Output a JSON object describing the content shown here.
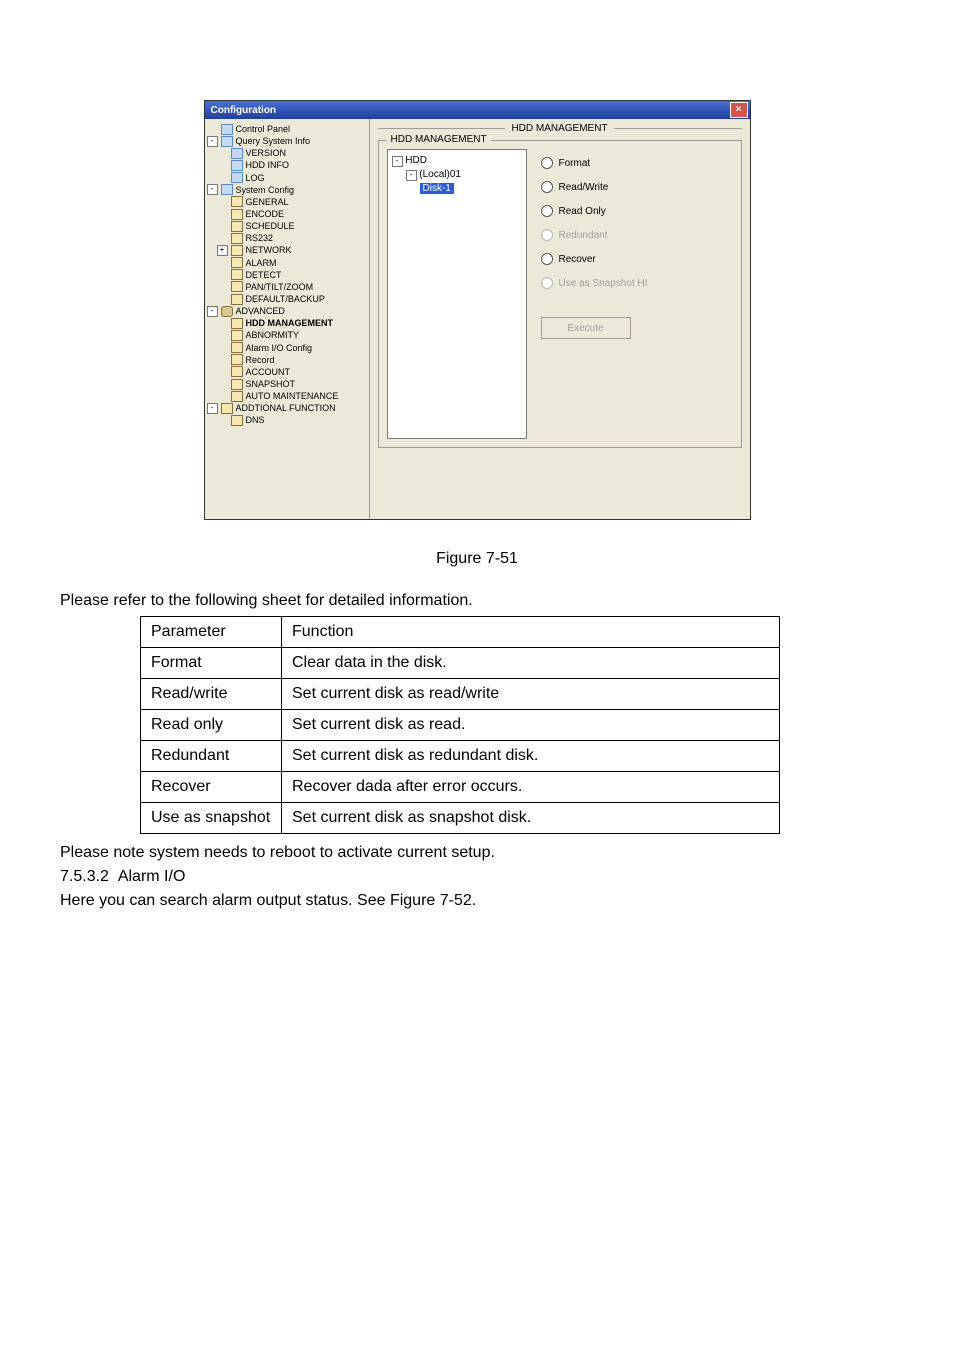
{
  "shot": {
    "title": "Configuration",
    "close_tip": "Close",
    "panel_title": "HDD MANAGEMENT",
    "groupbox_label": "HDD MANAGEMENT",
    "tree": [
      {
        "lv": 0,
        "ico": "sys",
        "label": "Control Panel",
        "exp": ""
      },
      {
        "lv": 0,
        "ico": "sys",
        "label": "Query System Info",
        "exp": "-"
      },
      {
        "lv": 1,
        "ico": "sys",
        "label": "VERSION"
      },
      {
        "lv": 1,
        "ico": "sys",
        "label": "HDD INFO"
      },
      {
        "lv": 1,
        "ico": "sys",
        "label": "LOG"
      },
      {
        "lv": 0,
        "ico": "sys",
        "label": "System Config",
        "exp": "-"
      },
      {
        "lv": 1,
        "ico": "folder",
        "label": "GENERAL"
      },
      {
        "lv": 1,
        "ico": "folder",
        "label": "ENCODE"
      },
      {
        "lv": 1,
        "ico": "folder",
        "label": "SCHEDULE"
      },
      {
        "lv": 1,
        "ico": "folder",
        "label": "RS232"
      },
      {
        "lv": 1,
        "ico": "folder",
        "label": "NETWORK",
        "exp": "+"
      },
      {
        "lv": 1,
        "ico": "folder",
        "label": "ALARM"
      },
      {
        "lv": 1,
        "ico": "folder",
        "label": "DETECT"
      },
      {
        "lv": 1,
        "ico": "folder",
        "label": "PAN/TILT/ZOOM"
      },
      {
        "lv": 1,
        "ico": "folder",
        "label": "DEFAULT/BACKUP"
      },
      {
        "lv": 0,
        "ico": "gear",
        "label": "ADVANCED",
        "exp": "-"
      },
      {
        "lv": 1,
        "ico": "folder",
        "label": "HDD MANAGEMENT",
        "bold": true
      },
      {
        "lv": 1,
        "ico": "folder",
        "label": "ABNORMITY"
      },
      {
        "lv": 1,
        "ico": "folder",
        "label": "Alarm I/O Config"
      },
      {
        "lv": 1,
        "ico": "folder",
        "label": "Record"
      },
      {
        "lv": 1,
        "ico": "folder",
        "label": "ACCOUNT"
      },
      {
        "lv": 1,
        "ico": "folder",
        "label": "SNAPSHOT"
      },
      {
        "lv": 1,
        "ico": "folder",
        "label": "AUTO MAINTENANCE"
      },
      {
        "lv": 0,
        "ico": "folder",
        "label": "ADDTIONAL FUNCTION",
        "exp": "-"
      },
      {
        "lv": 1,
        "ico": "folder",
        "label": "DNS"
      }
    ],
    "inner_tree": {
      "root": "HDD",
      "child": "(Local)01",
      "leaf": "Disk-1"
    },
    "radios": [
      {
        "label": "Format",
        "enabled": true
      },
      {
        "label": "Read/Write",
        "enabled": true
      },
      {
        "label": "Read Only",
        "enabled": true
      },
      {
        "label": "Redundant",
        "enabled": false
      },
      {
        "label": "Recover",
        "enabled": true
      },
      {
        "label": "Use as Snapshot HI",
        "enabled": false
      }
    ],
    "exec_label": "Execute"
  },
  "doc": {
    "fig_caption": "Figure 7-51",
    "intro": "Please refer to the following sheet for detailed information.",
    "table": {
      "header": {
        "p": "Parameter",
        "f": "Function"
      },
      "rows": [
        {
          "p": "Format",
          "f": "Clear data in the disk."
        },
        {
          "p": "Read/write",
          "f": "Set current disk as read/write"
        },
        {
          "p": "Read only",
          "f": "Set current disk as read."
        },
        {
          "p": "Redundant",
          "f": "Set current disk as redundant disk."
        },
        {
          "p": "Recover",
          "f": "Recover dada after error occurs."
        },
        {
          "p": "Use as snapshot",
          "f": "Set current disk as snapshot disk."
        }
      ]
    },
    "note": "Please note system needs to reboot to activate current setup.",
    "sec_num": "7.5.3.2",
    "sec_title": "Alarm I/O",
    "sec_body": "Here you can search alarm output status. See Figure 7-52."
  }
}
